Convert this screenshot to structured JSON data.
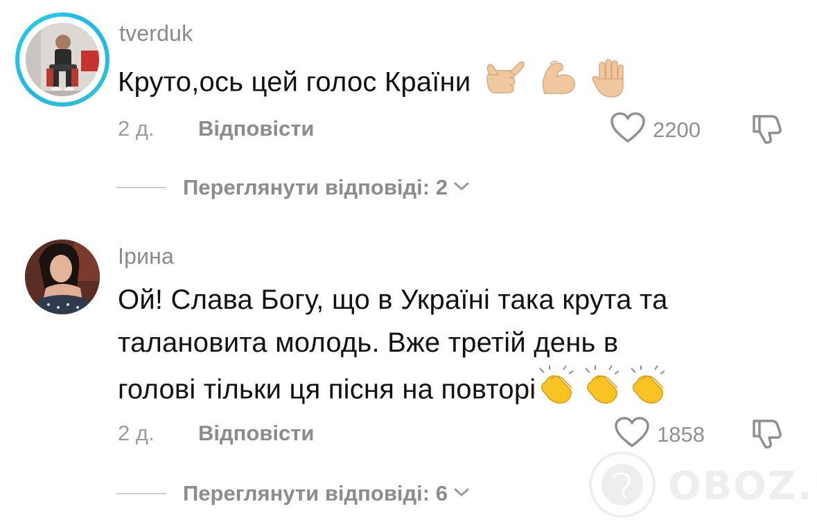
{
  "comments": [
    {
      "username": "tverduk",
      "text": "Круто,ось цей голос Країни",
      "emojis": [
        "call-me-hand-emoji",
        "flexed-biceps-emoji",
        "raised-hand-emoji"
      ],
      "time": "2 д.",
      "reply_label": "Відповісти",
      "likes": "2200",
      "view_replies": "Переглянути відповіді: 2"
    },
    {
      "username": "Ірина",
      "text_lines": [
        "Ой! Слава Богу, що в Україні така крута та",
        "талановита молодь. Вже третій день в",
        "голові тільки ця пісня на повторі"
      ],
      "emojis": [
        "clapping-hands-emoji",
        "clapping-hands-emoji",
        "clapping-hands-emoji"
      ],
      "time": "2 д.",
      "reply_label": "Відповісти",
      "likes": "1858",
      "view_replies": "Переглянути відповіді: 6"
    }
  ],
  "watermark": {
    "text": "OBOZ.UA"
  },
  "colors": {
    "text_primary": "#111111",
    "text_secondary": "#8c8c8c",
    "story_ring": "#1fb6e8",
    "emoji_skin": "#f2c9a0",
    "emoji_clap": "#f7c325"
  }
}
